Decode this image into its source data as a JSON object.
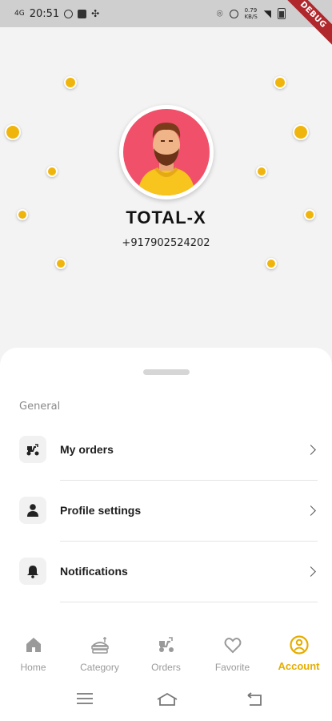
{
  "status_bar": {
    "signal": "4G",
    "time": "20:51",
    "network_speed": "0.79\nKB/S",
    "debug_ribbon": "DEBUG"
  },
  "profile": {
    "name": "TOTAL-X",
    "phone": "+917902524202"
  },
  "menu": {
    "section_label": "General",
    "items": [
      {
        "label": "My orders",
        "icon": "scooter-delivery-icon"
      },
      {
        "label": "Profile settings",
        "icon": "person-icon"
      },
      {
        "label": "Notifications",
        "icon": "bell-icon"
      }
    ]
  },
  "bottom_nav": {
    "items": [
      {
        "label": "Home",
        "icon": "home-icon",
        "active": false
      },
      {
        "label": "Category",
        "icon": "category-icon",
        "active": false
      },
      {
        "label": "Orders",
        "icon": "scooter-delivery-icon",
        "active": false
      },
      {
        "label": "Favorite",
        "icon": "heart-icon",
        "active": false
      },
      {
        "label": "Account",
        "icon": "account-icon",
        "active": true
      }
    ]
  },
  "colors": {
    "accent": "#e6ad00",
    "dot": "#f0b50d",
    "avatar_bg": "#f0506a",
    "background": "#f3f3f3"
  }
}
